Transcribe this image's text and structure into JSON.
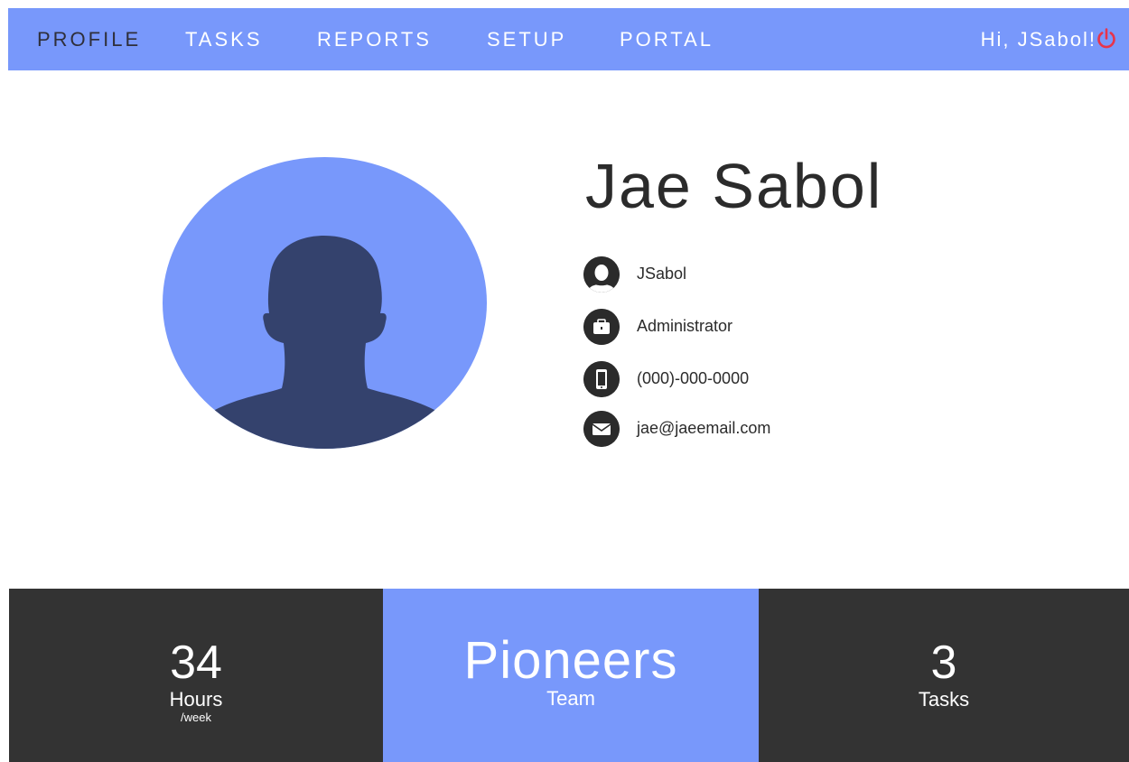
{
  "nav": {
    "items": [
      {
        "label": "PROFILE",
        "active": true
      },
      {
        "label": "TASKS",
        "active": false
      },
      {
        "label": "REPORTS",
        "active": false
      },
      {
        "label": "SETUP",
        "active": false
      },
      {
        "label": "PORTAL",
        "active": false
      }
    ],
    "greeting": "Hi, JSabol!",
    "logout_icon": "power-icon"
  },
  "profile": {
    "name": "Jae Sabol",
    "avatar_icon": "user-silhouette-icon",
    "details": [
      {
        "icon": "user-icon",
        "text": "JSabol"
      },
      {
        "icon": "briefcase-icon",
        "text": "Administrator"
      },
      {
        "icon": "phone-icon",
        "text": "(000)-000-0000"
      },
      {
        "icon": "envelope-icon",
        "text": "jae@jaeemail.com"
      }
    ]
  },
  "stats": {
    "hours": {
      "value": "34",
      "label": "Hours",
      "sublabel": "/week"
    },
    "team": {
      "value": "Pioneers",
      "label": "Team"
    },
    "tasks": {
      "value": "3",
      "label": "Tasks"
    }
  },
  "colors": {
    "accent": "#7898fb",
    "dark": "#333333",
    "logout": "#e8344a",
    "avatar_figure": "#34426d"
  }
}
